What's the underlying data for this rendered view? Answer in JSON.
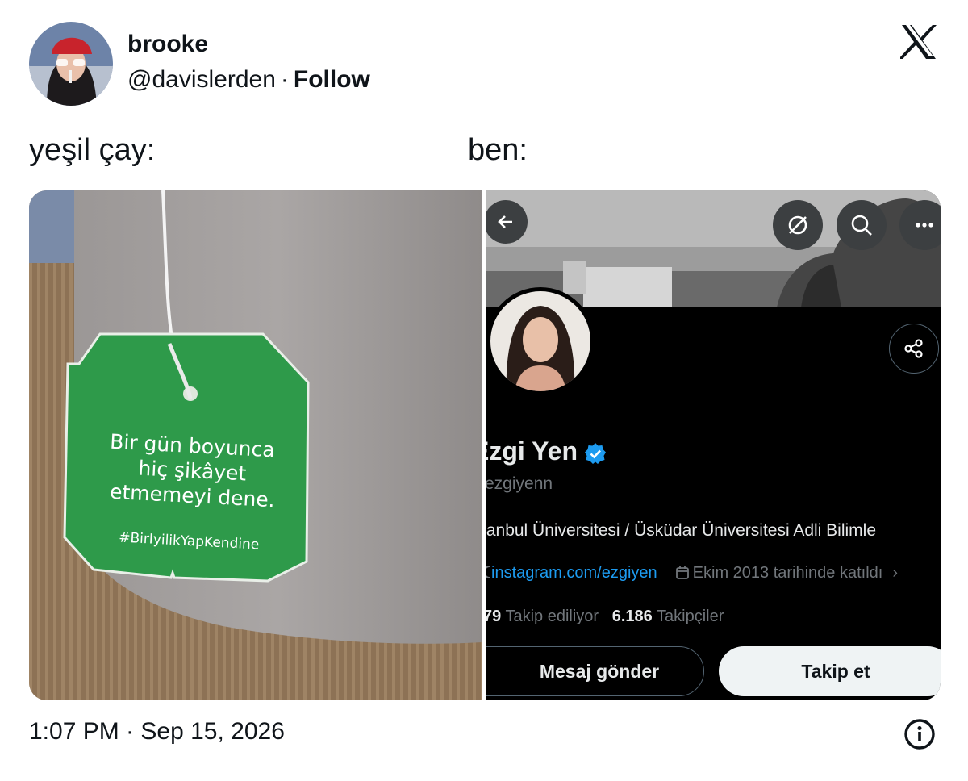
{
  "tweet": {
    "author": {
      "name": "brooke",
      "handle": "@davislerden",
      "separator": "·",
      "follow_label": "Follow"
    },
    "brand_icon": "x-logo-icon",
    "captions": {
      "left": "yeşil çay:",
      "right": "ben:"
    },
    "timestamp": "1:07 PM · Sep 15, 2026",
    "info_icon": "info-icon"
  },
  "media_left": {
    "tag_lines": [
      "Bir gün boyunca",
      "hiç şikâyet",
      "etmemeyi dene."
    ],
    "hashtag": "#BirIyilikYapKendine",
    "colors": {
      "tag_green": "#2e9a4a",
      "mug": "#a7a3a2"
    }
  },
  "media_right": {
    "profile": {
      "name": "Ezgi Yen",
      "handle": "@ezgiyenn",
      "handle_visible": "ezgiyenn",
      "bio": "İstanbul Üniversitesi / Üsküdar Üniversitesi Adli Bilimler",
      "bio_visible": "tanbul Üniversitesi / Üsküdar Üniversitesi Adli Bilimle",
      "link": "instagram.com/ezgiyen",
      "joined": "Ekim 2013 tarihinde katıldı",
      "following_count_visible": "79",
      "following_label": "Takip ediliyor",
      "followers_count": "6.186",
      "followers_label": "Takipçiler",
      "message_button": "Mesaj gönder",
      "follow_button": "Takip et"
    },
    "icons": [
      "back-arrow-icon",
      "grok-icon",
      "search-icon",
      "more-icon",
      "share-icon",
      "verified-badge-icon",
      "link-icon",
      "calendar-icon"
    ],
    "colors": {
      "background": "#000000",
      "verified": "#1d9bf0",
      "link": "#1d9bf0"
    }
  }
}
